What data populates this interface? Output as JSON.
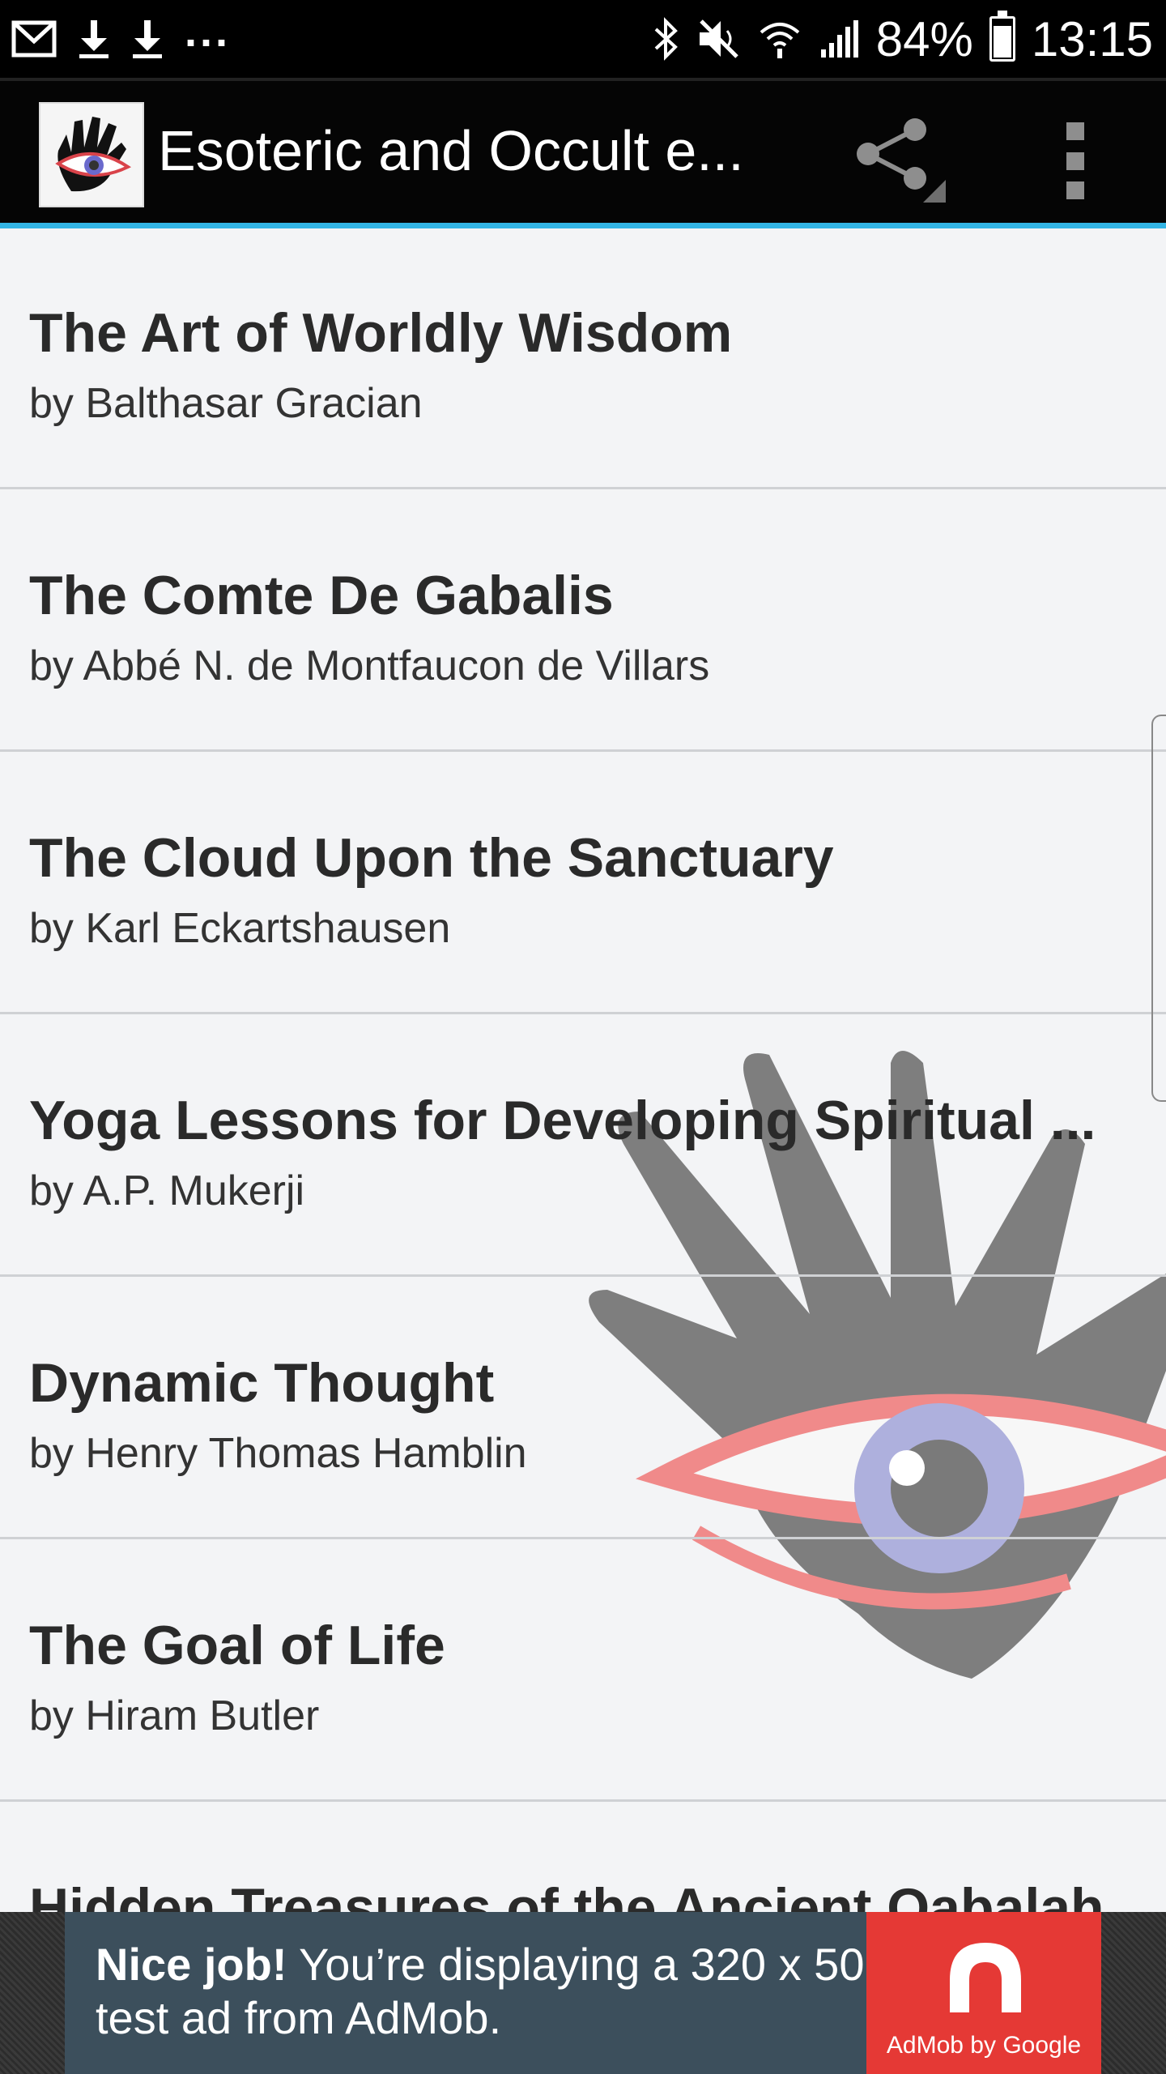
{
  "status_bar": {
    "battery_percent": "84%",
    "time": "13:15",
    "overflow": "...",
    "icons": [
      "gmail-icon",
      "download-icon",
      "download-icon",
      "bluetooth-icon",
      "mute-icon",
      "wifi-icon",
      "signal-icon",
      "battery-icon"
    ]
  },
  "app_bar": {
    "title": "Esoteric and Occult e...",
    "icons": [
      "app-logo-icon",
      "share-icon",
      "overflow-menu-icon"
    ],
    "accent_color": "#33b5e5"
  },
  "books": [
    {
      "title": "The Art of Worldly Wisdom",
      "author": "by Balthasar Gracian"
    },
    {
      "title": "The Comte De Gabalis",
      "author": "by Abbé N. de Montfaucon de Villars"
    },
    {
      "title": "The Cloud Upon the Sanctuary",
      "author": "by Karl Eckartshausen"
    },
    {
      "title": "Yoga Lessons for Developing Spiritual ...",
      "author": "by A.P. Mukerji"
    },
    {
      "title": "Dynamic Thought",
      "author": "by Henry Thomas Hamblin"
    },
    {
      "title": "The Goal of Life",
      "author": "by Hiram Butler"
    },
    {
      "title": "Hidden Treasures of the Ancient Qabalah",
      "author": ""
    }
  ],
  "ad": {
    "headline": "Nice job!",
    "body": " You’re displaying a 320 x 50 test ad from AdMob.",
    "logo_caption": "AdMob by Google",
    "brand_color": "#e53935"
  }
}
